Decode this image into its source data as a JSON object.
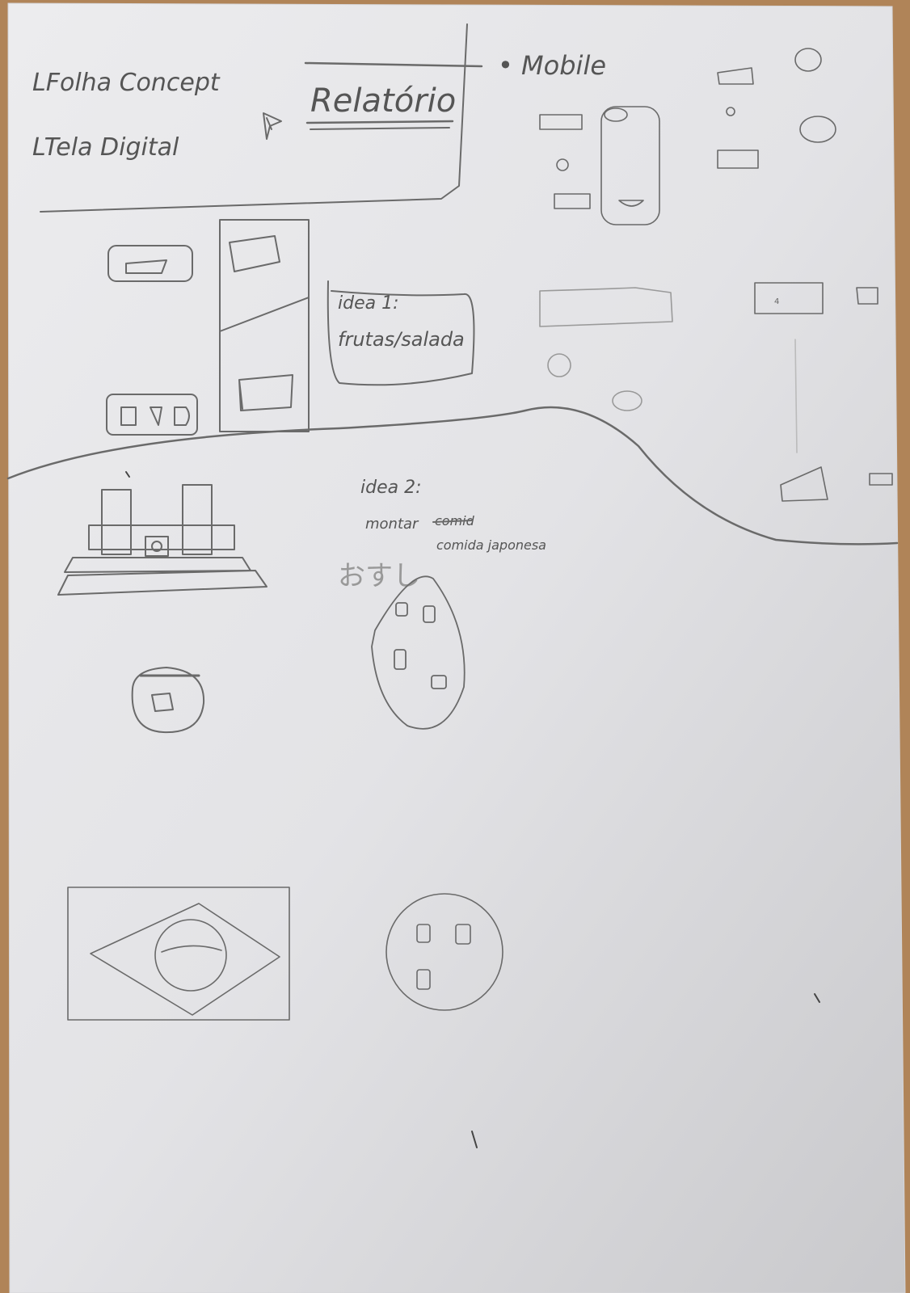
{
  "header": {
    "line1": "LFolha Concept",
    "line2": "LTela Digital",
    "title": "Relatório",
    "mobile_label": "• Mobile"
  },
  "ideas": {
    "idea1_title": "idea 1:",
    "idea1_text": "frutas/salada",
    "idea2_title": "idea 2:",
    "idea2_text_a": "montar",
    "idea2_struck": "comid",
    "idea2_text_b": "comida japonesa",
    "idea2_japanese": "おすし"
  },
  "mobile_small_text": {
    "box_label": "4"
  }
}
